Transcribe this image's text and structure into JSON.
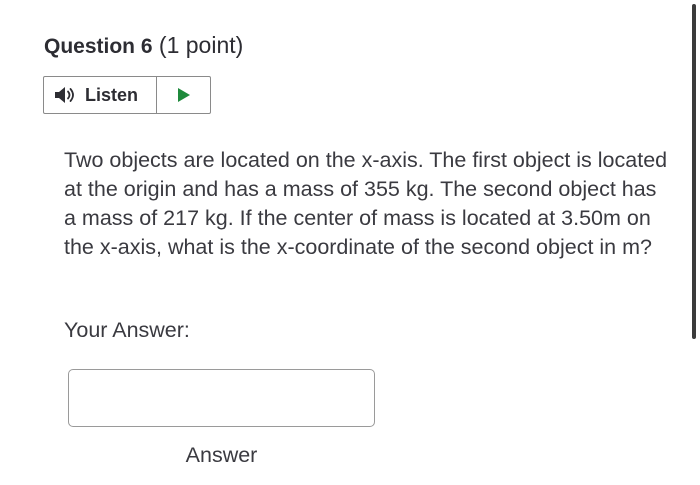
{
  "question": {
    "number_label": "Question 6",
    "points_label": "(1 point)",
    "text": "Two objects are located on the x-axis. The first object is located at the origin and has a mass of 355 kg. The second object has a mass of 217 kg. If the center of mass is located at 3.50m on the x-axis, what is the x-coordinate of the second object in m?"
  },
  "listen": {
    "label": "Listen",
    "speaker_icon": "speaker-icon",
    "play_icon": "play-icon",
    "play_color": "#1f8a3c"
  },
  "answer": {
    "label": "Your Answer:",
    "value": "",
    "caption": "Answer"
  }
}
